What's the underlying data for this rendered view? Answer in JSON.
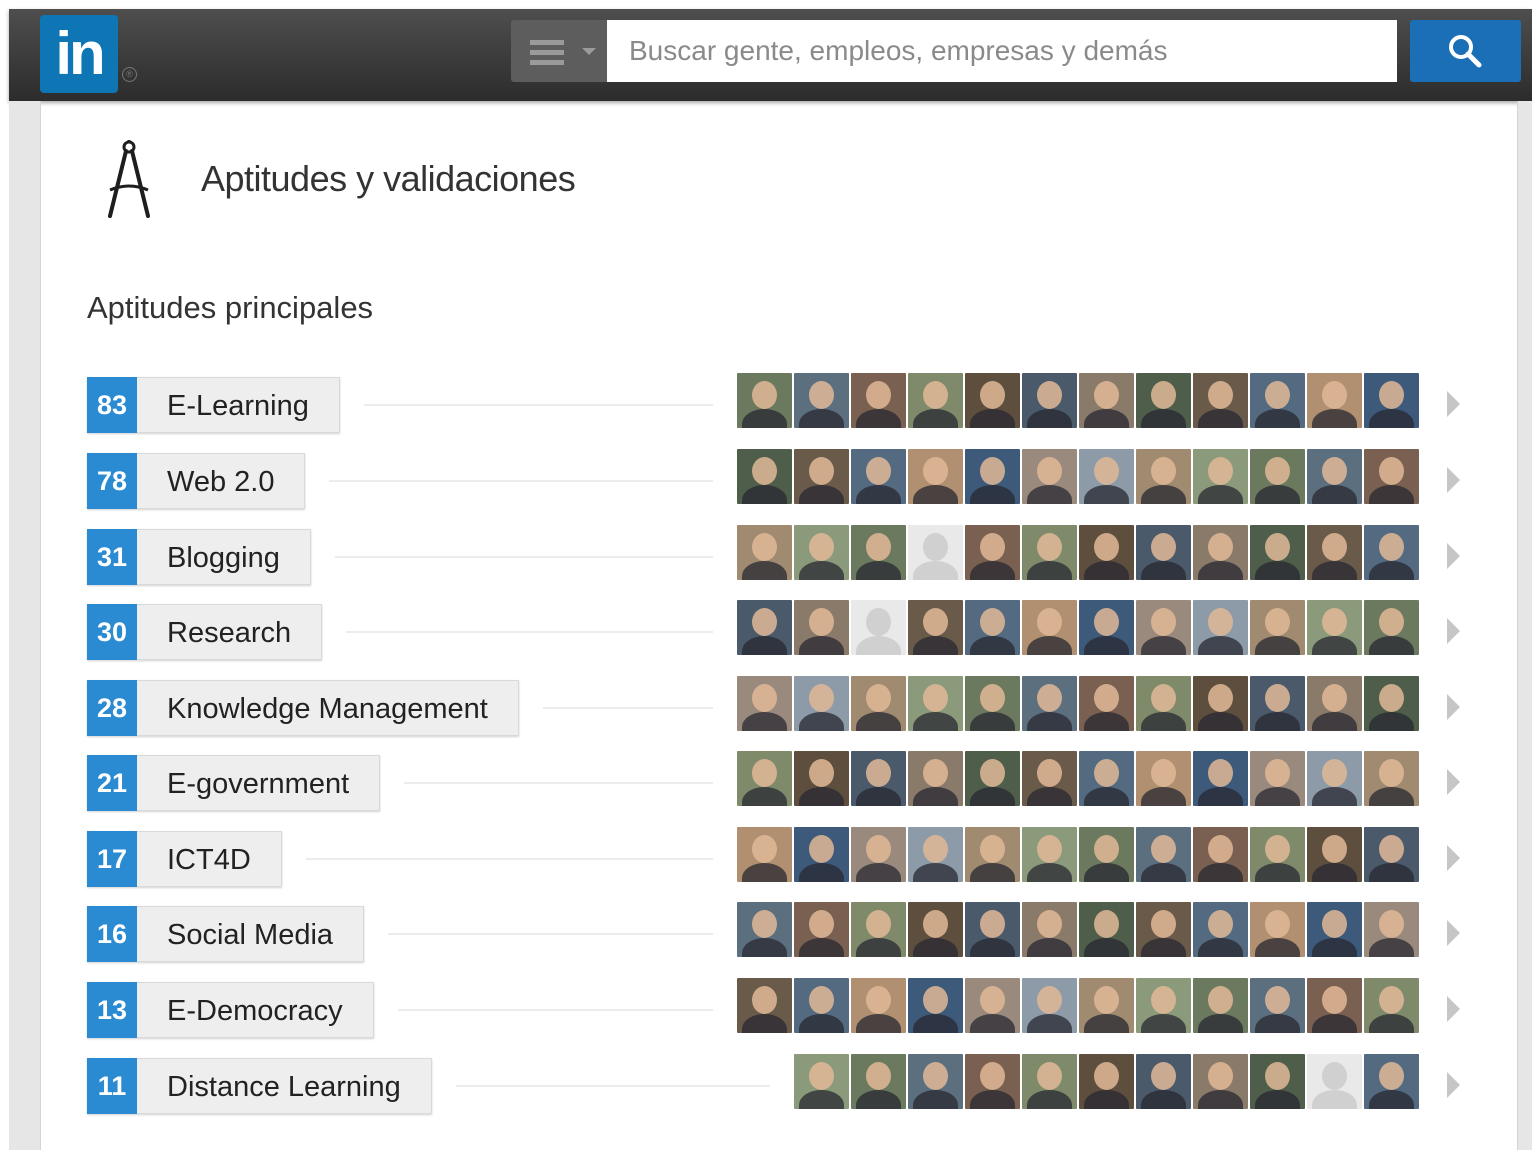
{
  "brand": {
    "logo_text": "in",
    "reg_mark": "®"
  },
  "search": {
    "placeholder": "Buscar gente, empleos, empresas y demás",
    "value": ""
  },
  "section": {
    "title": "Aptitudes y validaciones",
    "icon": "compass-icon"
  },
  "subsection": {
    "title": "Aptitudes principales"
  },
  "colors": {
    "header_bg": "#2c2c2c",
    "brand_blue": "#0e76b5",
    "count_blue": "#2a8ad2",
    "search_button": "#1a6fb7"
  },
  "skills": [
    {
      "count": "83",
      "name": "E-Learning",
      "endorser_count_shown": 12
    },
    {
      "count": "78",
      "name": "Web 2.0",
      "endorser_count_shown": 12
    },
    {
      "count": "31",
      "name": "Blogging",
      "endorser_count_shown": 12
    },
    {
      "count": "30",
      "name": "Research",
      "endorser_count_shown": 12
    },
    {
      "count": "28",
      "name": "Knowledge Management",
      "endorser_count_shown": 12
    },
    {
      "count": "21",
      "name": "E-government",
      "endorser_count_shown": 12
    },
    {
      "count": "17",
      "name": "ICT4D",
      "endorser_count_shown": 12
    },
    {
      "count": "16",
      "name": "Social Media",
      "endorser_count_shown": 12
    },
    {
      "count": "13",
      "name": "E-Democracy",
      "endorser_count_shown": 12
    },
    {
      "count": "11",
      "name": "Distance Learning",
      "endorser_count_shown": 11
    }
  ]
}
